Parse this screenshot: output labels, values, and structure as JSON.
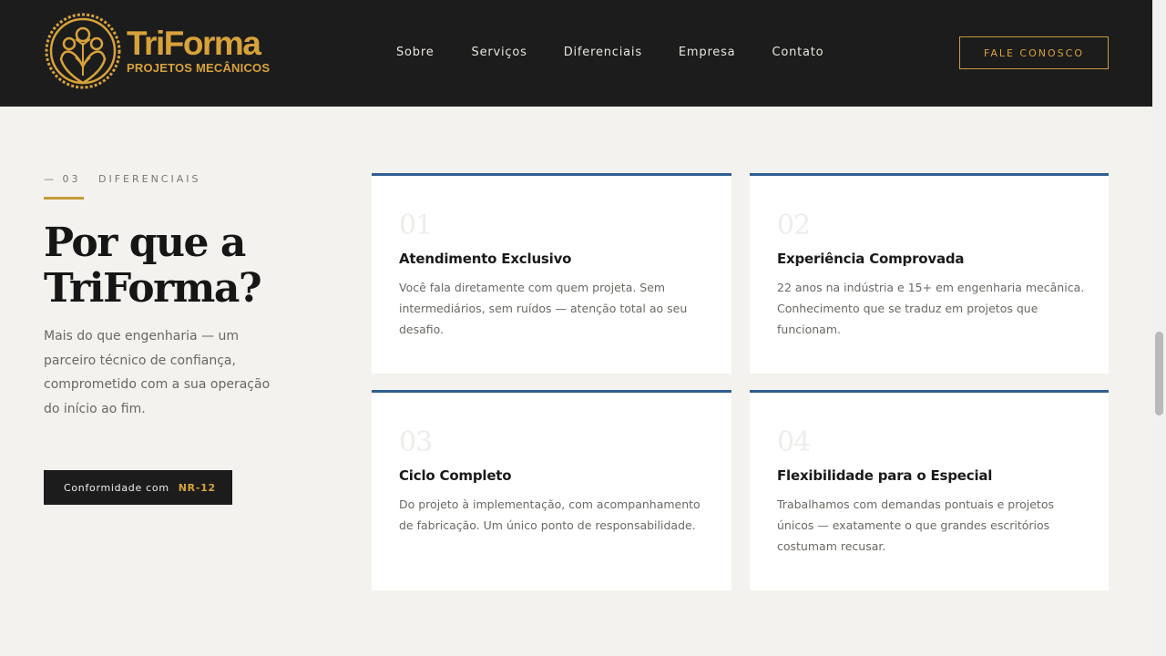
{
  "brand": {
    "name": "TriForma",
    "tagline": "PROJETOS MECÂNICOS",
    "colors": {
      "gold": "#d8a23a",
      "dark": "#1c1c1c",
      "blue": "#2f5f93",
      "bg": "#f3f2ee"
    }
  },
  "nav": {
    "items": [
      "Sobre",
      "Serviços",
      "Diferenciais",
      "Empresa",
      "Contato"
    ],
    "cta": "FALE CONOSCO"
  },
  "section": {
    "eyebrow": "— 03   DIFERENCIAIS",
    "title": "Por que a TriForma?",
    "lede": "Mais do que engenharia — um parceiro técnico de confiança, comprometido com a sua operação do início ao fim.",
    "badge_text": "Conformidade com",
    "badge_highlight": "NR-12"
  },
  "cards": [
    {
      "number": "01",
      "title": "Atendimento Exclusivo",
      "description": "Você fala diretamente com quem projeta. Sem intermediários, sem ruídos — atenção total ao seu desafio."
    },
    {
      "number": "02",
      "title": "Experiência Comprovada",
      "description": "22 anos na indústria e 15+ em engenharia mecânica. Conhecimento que se traduz em projetos que funcionam."
    },
    {
      "number": "03",
      "title": "Ciclo Completo",
      "description": "Do projeto à implementação, com acompanhamento de fabricação. Um único ponto de responsabilidade."
    },
    {
      "number": "04",
      "title": "Flexibilidade para o Especial",
      "description": "Trabalhamos com demandas pontuais e projetos únicos — exatamente o que grandes escritórios costumam recusar."
    }
  ]
}
